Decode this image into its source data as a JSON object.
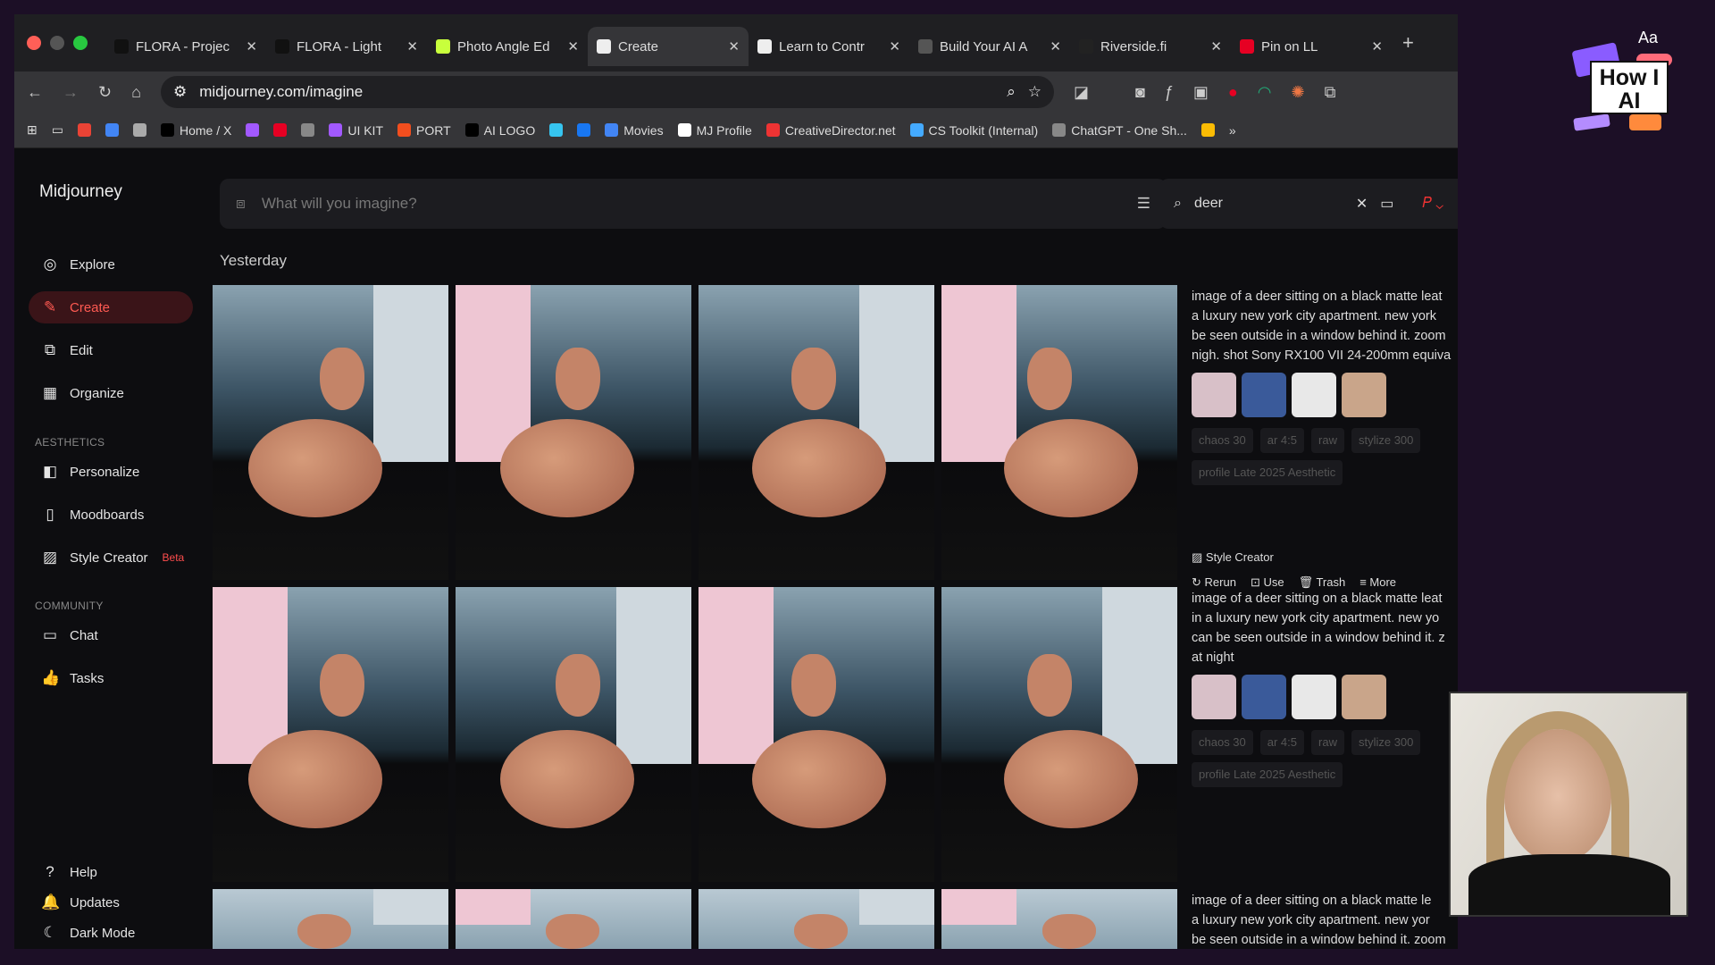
{
  "browser": {
    "tabs": [
      {
        "label": "FLORA - Projec",
        "fav": "#111"
      },
      {
        "label": "FLORA - Light",
        "fav": "#111"
      },
      {
        "label": "Photo Angle Ed",
        "fav": "#c8ff3c"
      },
      {
        "label": "Create",
        "fav": "#eee",
        "active": true
      },
      {
        "label": "Learn to Contr",
        "fav": "#eee"
      },
      {
        "label": "Build Your AI A",
        "fav": "#555"
      },
      {
        "label": "Riverside.fi",
        "fav": "#222"
      },
      {
        "label": "Pin on LL",
        "fav": "#e60023"
      }
    ],
    "url": "midjourney.com/imagine",
    "bookmarks": [
      {
        "label": "",
        "c": "#ea4335"
      },
      {
        "label": "",
        "c": "#4285f4"
      },
      {
        "label": "",
        "c": "#aaa"
      },
      {
        "label": "Home / X",
        "c": "#000"
      },
      {
        "label": "",
        "c": "#a259ff"
      },
      {
        "label": "",
        "c": "#e60023"
      },
      {
        "label": "",
        "c": "#888"
      },
      {
        "label": "UI KIT",
        "c": "#a259ff"
      },
      {
        "label": "PORT",
        "c": "#f24e1e"
      },
      {
        "label": "AI LOGO",
        "c": "#000"
      },
      {
        "label": "",
        "c": "#36c5f0"
      },
      {
        "label": "",
        "c": "#1877f2"
      },
      {
        "label": "Movies",
        "c": "#4285f4"
      },
      {
        "label": "MJ Profile",
        "c": "#fff"
      },
      {
        "label": "CreativeDirector.net",
        "c": "#e33"
      },
      {
        "label": "CS Toolkit (Internal)",
        "c": "#4af"
      },
      {
        "label": "ChatGPT - One Sh...",
        "c": "#888"
      },
      {
        "label": "",
        "c": "#fbbc04"
      }
    ]
  },
  "app": {
    "brand": "Midjourney",
    "nav": [
      {
        "label": "Explore",
        "icon": "compass"
      },
      {
        "label": "Create",
        "icon": "brush"
      },
      {
        "label": "Edit",
        "icon": "edit"
      },
      {
        "label": "Organize",
        "icon": "grid"
      }
    ],
    "aesthetics_label": "AESTHETICS",
    "aesthetics": [
      {
        "label": "Personalize"
      },
      {
        "label": "Moodboards"
      },
      {
        "label": "Style Creator"
      }
    ],
    "beta": "Beta",
    "community_label": "COMMUNITY",
    "community": [
      {
        "label": "Chat"
      },
      {
        "label": "Tasks"
      }
    ],
    "bottom": [
      {
        "label": "Help"
      },
      {
        "label": "Updates"
      },
      {
        "label": "Dark Mode"
      }
    ],
    "search_placeholder": "What will you imagine?",
    "filter_value": "deer",
    "section": "Yesterday",
    "jobs": [
      {
        "prompt": [
          "image of a deer sitting on a black matte leat",
          "a luxury new york city apartment. new york",
          "be seen outside in a window behind it. zoom",
          "nigh. shot Sony RX100 VII 24-200mm equiva"
        ],
        "chips": [
          "chaos 30",
          "ar 4:5",
          "raw",
          "stylize 300",
          "profile Late 2025 Aesthetic"
        ],
        "style_creator": "Style Creator",
        "actions": [
          "Rerun",
          "Use",
          "Trash",
          "More"
        ]
      },
      {
        "prompt": [
          "image of a deer sitting on a black matte leat",
          "in a luxury new york city apartment. new yo",
          "can be seen outside in a window behind it. z",
          "at night"
        ],
        "chips": [
          "chaos 30",
          "ar 4:5",
          "raw",
          "stylize 300",
          "profile Late 2025 Aesthetic"
        ]
      },
      {
        "prompt": [
          "image of a deer sitting on a black matte le",
          "a luxury new york city apartment. new yor",
          "be seen outside in a window behind it. zoom"
        ]
      }
    ]
  },
  "overlay": {
    "logo_text": "How I AI",
    "logo_aa": "Aa"
  }
}
